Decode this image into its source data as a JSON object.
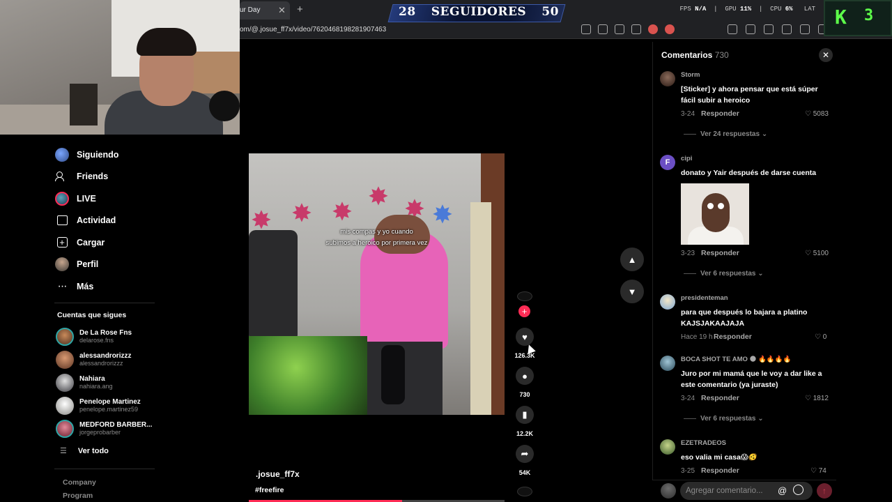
{
  "browser": {
    "tab_title": "ur Day",
    "tab_close": "✕",
    "tab_new": "+",
    "url": "om/@.josue_ff7x/video/7620468198281907463",
    "hud": {
      "fps_label": "FPS",
      "fps_value": "N/A",
      "gpu_label": "GPU",
      "gpu_value": "11%",
      "cpu_label": "CPU",
      "cpu_value": "6%",
      "lat_label": "LAT"
    }
  },
  "overlay": {
    "followers_current": "28",
    "followers_label": "SEGUIDORES",
    "followers_goal": "50",
    "kick_letter": "K",
    "kick_number": "3",
    "kick_color": "#5dff4a"
  },
  "sidebar": {
    "items": [
      {
        "label": "Siguiendo",
        "icon": "following-icon"
      },
      {
        "label": "Friends",
        "icon": "friends-icon"
      },
      {
        "label": "LIVE",
        "icon": "live-icon"
      },
      {
        "label": "Actividad",
        "icon": "activity-icon"
      },
      {
        "label": "Cargar",
        "icon": "upload-icon"
      },
      {
        "label": "Perfil",
        "icon": "profile-icon"
      },
      {
        "label": "Más",
        "icon": "more-icon"
      }
    ],
    "following_title": "Cuentas que sigues",
    "following": [
      {
        "name": "De La Rose Fns",
        "handle": "delarose.fns",
        "color": "#7a5a3a"
      },
      {
        "name": "alessandrorizzz",
        "handle": "alessandrorizzz",
        "color": "#a06a4a"
      },
      {
        "name": "Nahiara",
        "handle": "nahiara.ang",
        "color": "#8d8d92"
      },
      {
        "name": "Penelope Martinez",
        "handle": "penelope.martinez59",
        "color": "#c9c7c2"
      },
      {
        "name": "MEDFORD BARBER...",
        "handle": "jorgeprobarber",
        "color": "#b0455a"
      }
    ],
    "see_all": "Ver todo",
    "footer": [
      "Company",
      "Program"
    ]
  },
  "video": {
    "caption_line1": "mis compas y yo cuando",
    "caption_line2": "subimos a heroico por primera vez",
    "author": ".josue_ff7x",
    "hashtag": "#freefire",
    "progress": 0.6,
    "likes": "126.3K",
    "comments": "730",
    "saves": "12.2K",
    "shares": "54K"
  },
  "comments_panel": {
    "title": "Comentarios",
    "count": "730",
    "reply_label": "Responder",
    "items": [
      {
        "user": "Storm",
        "text": "[Sticker] y ahora pensar que está súper fácil subir a heroico",
        "date": "3-24",
        "likes": "5083",
        "replies": "Ver 24 respuestas",
        "avatar_color": "#4a3a33"
      },
      {
        "user": "cipi",
        "text": "donato y Yair después de darse cuenta",
        "date": "3-23",
        "likes": "5100",
        "replies": "Ver 6 respuestas",
        "avatar_color": "#6b4fc4",
        "avatar_letter": "F"
      },
      {
        "user": "presidenteman",
        "text": "para que después lo bajara a platino KAJSJAKAAJAJA",
        "date": "Hace 19 h",
        "likes": "0",
        "avatar_color": "#c8d4e6"
      },
      {
        "user": "BOCA SHOT TE AMO 🌑 🔥🔥🔥🔥",
        "text": "Juro por mi mamá que le voy a dar like a este comentario (ya juraste)",
        "date": "3-24",
        "likes": "1812",
        "replies": "Ver 6 respuestas",
        "avatar_color": "#6c8fa0"
      },
      {
        "user": "EZETRADEOS",
        "text": "eso valia mi casa😱🫨",
        "date": "3-25",
        "likes": "74",
        "avatar_color": "#4a6a3a"
      }
    ],
    "input_placeholder": "Agregar comentario..."
  }
}
